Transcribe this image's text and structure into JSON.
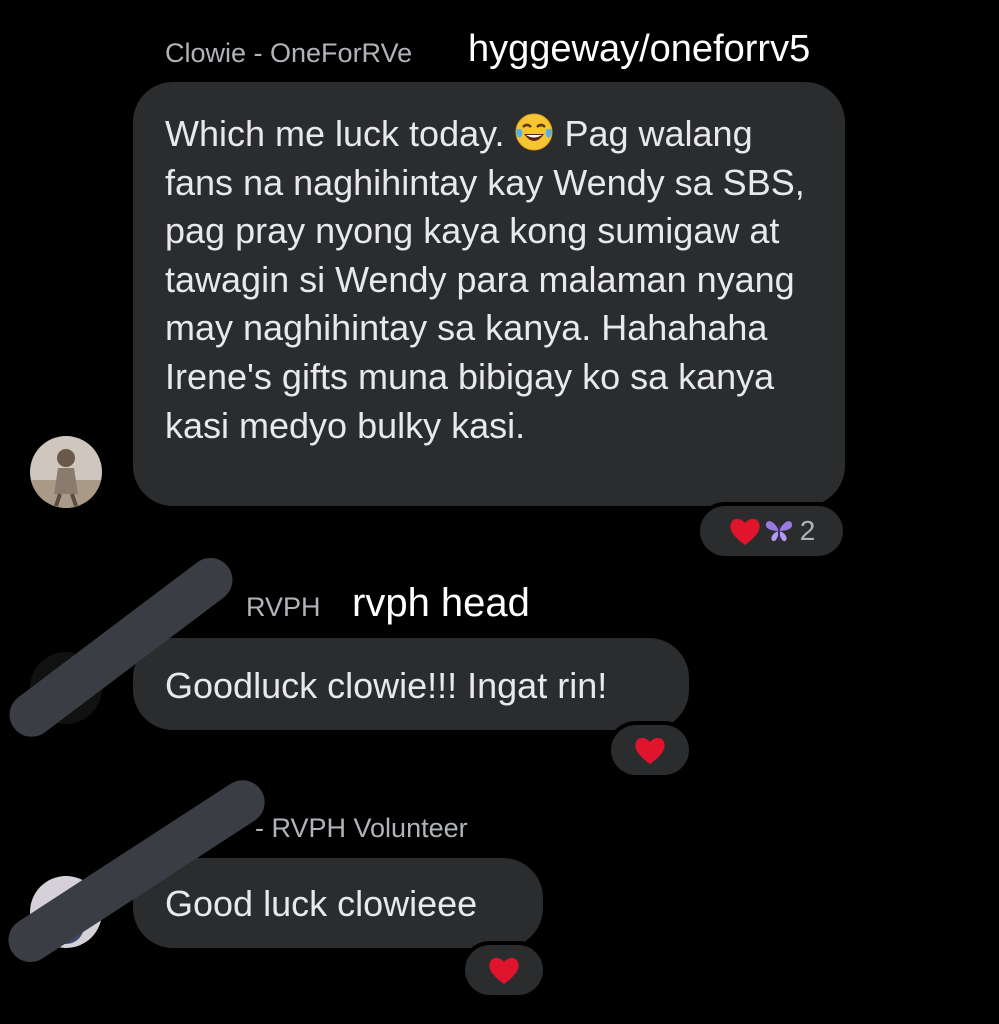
{
  "watermark": "hyggeway/oneforrv5",
  "messages": [
    {
      "sender": "Clowie - OneForRVe",
      "text_before_emoji": "Which me luck today. ",
      "emoji": "tears-of-joy-emoji",
      "text_after_emoji": " Pag walang fans na naghihintay kay Wendy sa SBS, pag pray nyong kaya kong sumigaw at tawagin si Wendy para malaman nyang may naghihintay sa kanya. Hahahaha Irene's gifts muna bibigay ko sa kanya kasi medyo bulky kasi.",
      "reactions": {
        "icons": [
          "heart-reaction",
          "butterfly-reaction"
        ],
        "count": "2"
      }
    },
    {
      "sender": "RVPH",
      "annotation": "rvph head",
      "text": "Goodluck clowie!!! Ingat rin!",
      "reactions": {
        "icons": [
          "heart-reaction"
        ]
      }
    },
    {
      "sender": "- RVPH Volunteer",
      "text": "Good luck clowieee",
      "reactions": {
        "icons": [
          "heart-reaction"
        ]
      }
    }
  ],
  "colors": {
    "background": "#000000",
    "bubble": "#2b2c2e",
    "sender_name": "#b0b3b8",
    "heart": "#e0142c",
    "redaction": "#3a3d44"
  }
}
